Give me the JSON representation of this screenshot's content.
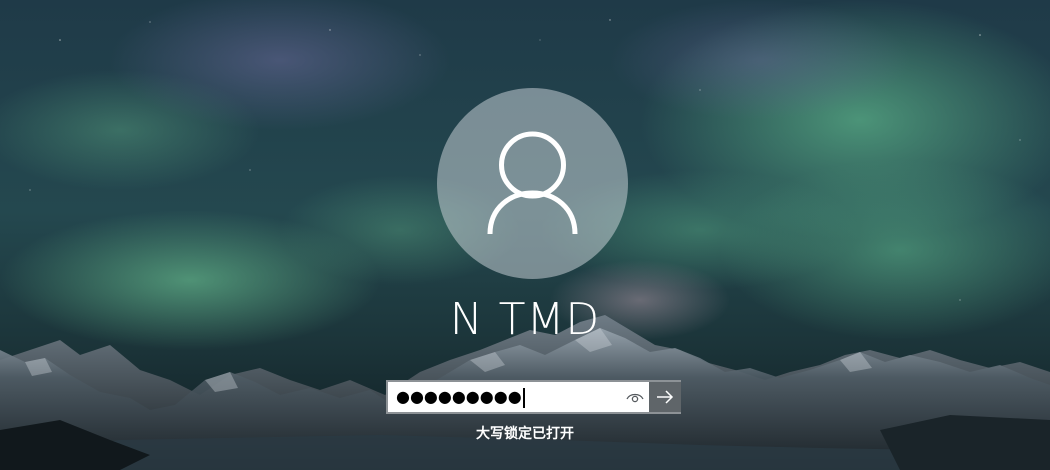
{
  "user": {
    "name": "N TMD",
    "avatar_icon": "person-silhouette-icon"
  },
  "password_field": {
    "masked_value": "●●●●●●●●●",
    "reveal_icon": "eye-icon",
    "submit_icon": "arrow-right-icon"
  },
  "status": {
    "caps_lock_message": "大写锁定已打开"
  },
  "colors": {
    "field_border": "#8d9296",
    "submit_bg": "#5f6569",
    "avatar_bg": "#cdd4da"
  }
}
